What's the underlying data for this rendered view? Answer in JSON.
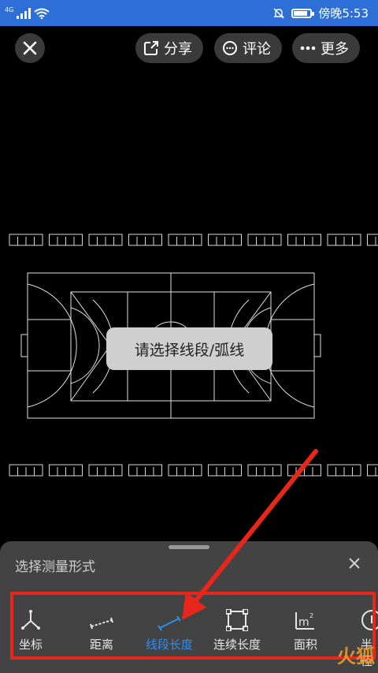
{
  "status": {
    "network": "4G",
    "time": "傍晚5:53",
    "battery_level": 0.75
  },
  "header": {
    "share_label": "分享",
    "comment_label": "评论",
    "more_label": "更多"
  },
  "toast": {
    "text": "请选择线段/弧线"
  },
  "sheet": {
    "title": "选择测量形式",
    "tools": [
      {
        "label": "坐标",
        "icon": "coordinate-icon"
      },
      {
        "label": "距离",
        "icon": "distance-icon"
      },
      {
        "label": "线段长度",
        "icon": "segment-length-icon",
        "active": true
      },
      {
        "label": "连续长度",
        "icon": "continuous-length-icon"
      },
      {
        "label": "面积",
        "icon": "area-icon"
      },
      {
        "label": "半径",
        "icon": "radius-icon"
      }
    ]
  },
  "colors": {
    "status_bar": "#2d6fd6",
    "active_tool": "#2f8ef0",
    "annotation": "#e8271c"
  },
  "watermark": {
    "text": "火狐"
  }
}
